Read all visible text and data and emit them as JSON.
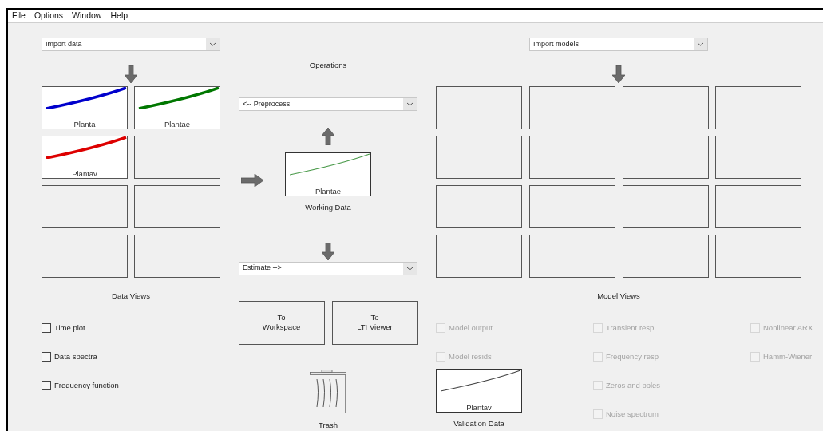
{
  "menu": [
    "File",
    "Options",
    "Window",
    "Help"
  ],
  "data": {
    "import": {
      "value": "Import data"
    },
    "slots": [
      {
        "kind": "plot",
        "label": "Planta",
        "color": "#0000cc"
      },
      {
        "kind": "plot",
        "label": "Plantae",
        "color": "#007700"
      },
      {
        "kind": "plot",
        "label": "Plantav",
        "color": "#dd0000"
      },
      {
        "kind": "empty"
      },
      {
        "kind": "empty"
      },
      {
        "kind": "empty"
      },
      {
        "kind": "empty"
      },
      {
        "kind": "empty"
      }
    ],
    "title": "Data Views",
    "views": [
      {
        "label": "Time plot",
        "checked": false,
        "disabled": false
      },
      {
        "label": "Data spectra",
        "checked": false,
        "disabled": false
      },
      {
        "label": "Frequency function",
        "checked": false,
        "disabled": false
      }
    ]
  },
  "operations": {
    "title": "Operations",
    "preprocess": {
      "value": "<-- Preprocess"
    },
    "working": {
      "label": "Plantae",
      "caption": "Working Data",
      "color": "#4a9a4a"
    },
    "estimate": {
      "value": "Estimate -->"
    },
    "buttons": [
      [
        "To",
        "Workspace"
      ],
      [
        "To",
        "LTI Viewer"
      ]
    ],
    "trash": "Trash"
  },
  "models": {
    "import": {
      "value": "Import models"
    },
    "slots": [
      {
        "kind": "empty"
      },
      {
        "kind": "empty"
      },
      {
        "kind": "empty"
      },
      {
        "kind": "empty"
      },
      {
        "kind": "empty"
      },
      {
        "kind": "empty"
      },
      {
        "kind": "empty"
      },
      {
        "kind": "empty"
      },
      {
        "kind": "empty"
      },
      {
        "kind": "empty"
      },
      {
        "kind": "empty"
      },
      {
        "kind": "empty"
      },
      {
        "kind": "empty"
      },
      {
        "kind": "empty"
      },
      {
        "kind": "empty"
      },
      {
        "kind": "empty"
      }
    ],
    "title": "Model Views",
    "view_columns": [
      [
        {
          "label": "Model output",
          "checked": false,
          "disabled": true
        },
        {
          "label": "Model resids",
          "checked": false,
          "disabled": true
        }
      ],
      [
        {
          "label": "Transient resp",
          "checked": false,
          "disabled": true
        },
        {
          "label": "Frequency resp",
          "checked": false,
          "disabled": true
        },
        {
          "label": "Zeros and poles",
          "checked": false,
          "disabled": true
        },
        {
          "label": "Noise spectrum",
          "checked": false,
          "disabled": true
        }
      ],
      [
        {
          "label": "Nonlinear ARX",
          "checked": false,
          "disabled": true
        },
        {
          "label": "Hamm-Wiener",
          "checked": false,
          "disabled": true
        }
      ]
    ],
    "validation": {
      "label": "Plantav",
      "caption": "Validation Data",
      "color": "#444444"
    }
  }
}
